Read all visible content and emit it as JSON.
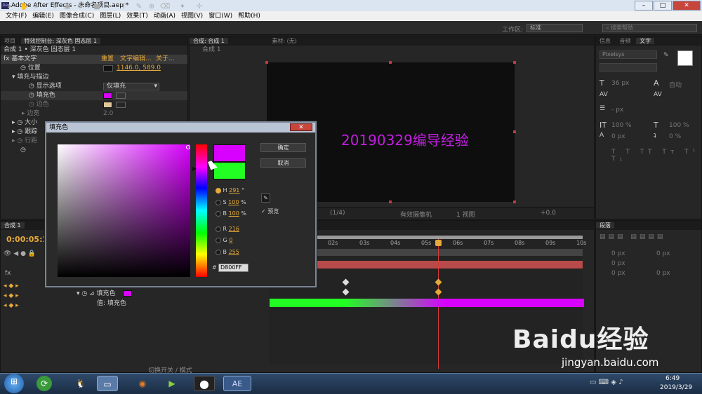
{
  "window": {
    "title": "Adobe After Effects - 未命名项目.aep *",
    "app_icon": "Ae"
  },
  "menu": [
    "文件(F)",
    "编辑(E)",
    "图像合成(C)",
    "图层(L)",
    "效果(T)",
    "动画(A)",
    "视图(V)",
    "窗口(W)",
    "帮助(H)"
  ],
  "toolbar": {
    "workspace_label": "工作区:",
    "workspace_value": "标准",
    "search_placeholder": "搜索帮助"
  },
  "left_panel": {
    "tabs": [
      "项目",
      "特效控制台: 深灰色 固态层 1"
    ],
    "header": "合成 1 • 深灰色 固态层 1",
    "effect_name": "基本文字",
    "effect_links": [
      "重置",
      "文字编辑...",
      "关于..."
    ],
    "position_label": "位置",
    "position_value": "1146.0, 589.0",
    "fill_stroke_label": "填充与描边",
    "display_option_label": "显示选项",
    "display_option_value": "仅填充",
    "fill_color_label": "填充色",
    "stroke_color_label": "边色",
    "stroke_width_label": "边宽",
    "stroke_width_value": "2.0",
    "size_label": "大小",
    "tracking_label": "跟踪",
    "line_spacing_label": "行距"
  },
  "comp_panel": {
    "tabs": [
      "合成: 合成 1",
      "素材: (无)"
    ],
    "comp_tab": "合成 1",
    "text": "20190329编导经验",
    "controls": [
      "(1/4)",
      "有效摄像机",
      "1 视图",
      "+0.0"
    ]
  },
  "right_panel": {
    "tabs": [
      "信息",
      "音频",
      "文字"
    ],
    "font": "Pixelsys",
    "size_value": "36 px",
    "leading_value": "自动",
    "scale_v": "100 %",
    "scale_h": "100 %",
    "baseline": "0 px",
    "tsume": "0 %",
    "unit_px": "- px"
  },
  "paragraph_panel": {
    "tab": "段落",
    "values": [
      "0 px",
      "0 px",
      "0 px",
      "0 px",
      "0 px"
    ]
  },
  "timeline": {
    "tab": "合成 1",
    "timecode": "0:00:05:1",
    "ruler": [
      "02s",
      "03s",
      "04s",
      "05s",
      "06s",
      "07s",
      "08s",
      "09s",
      "10s"
    ],
    "layer_prop": "填充色",
    "value_label": "值: 填充色",
    "toggle_label": "切换开关 / 模式"
  },
  "dialog": {
    "title": "填充色",
    "ok": "确定",
    "cancel": "取消",
    "preview_label": "预览",
    "new_color": "#d800ff",
    "old_color": "#22ff22",
    "channels": [
      {
        "key": "H",
        "value": "291",
        "unit": "°",
        "selected": true
      },
      {
        "key": "S",
        "value": "100",
        "unit": "%",
        "selected": false
      },
      {
        "key": "B",
        "value": "100",
        "unit": "%",
        "selected": false
      },
      {
        "key": "R",
        "value": "216",
        "unit": "",
        "selected": false
      },
      {
        "key": "G",
        "value": "0",
        "unit": "",
        "selected": false
      },
      {
        "key": "B",
        "value": "255",
        "unit": "",
        "selected": false
      }
    ],
    "hex_label": "#",
    "hex_value": "D800FF"
  },
  "taskbar": {
    "time": "6:49",
    "date": "2019/3/29",
    "ae_label": "AE"
  },
  "watermark": {
    "logo": "Baidu经验",
    "url": "jingyan.baidu.com"
  },
  "colors": {
    "accent_orange": "#e6a93a",
    "fill_magenta": "#d800ff",
    "fill_green": "#22ff22",
    "timeline_bar": "#b84a4a"
  }
}
